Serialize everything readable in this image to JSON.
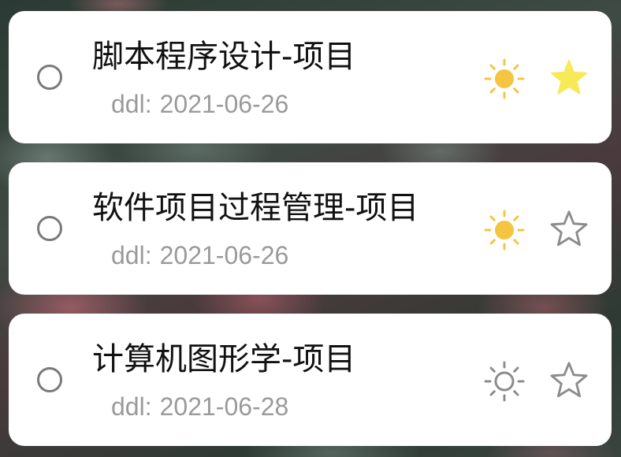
{
  "colors": {
    "card_background": "#ffffff",
    "title_text": "#111111",
    "ddl_text": "#9a9a9a",
    "radio_border": "#7a7a7a",
    "sun_active": "#f5c542",
    "sun_inactive": "#8c8c8c",
    "star_active": "#f7e957",
    "star_inactive": "#8c8c8c"
  },
  "tasks": [
    {
      "title": "脚本程序设计-项目",
      "ddl_prefix": "ddl:",
      "ddl_date": "2021-06-26",
      "my_day": true,
      "important": true,
      "sun_icon": "sun-icon",
      "star_icon": "star-filled-icon"
    },
    {
      "title": "软件项目过程管理-项目",
      "ddl_prefix": "ddl:",
      "ddl_date": "2021-06-26",
      "my_day": true,
      "important": false,
      "sun_icon": "sun-icon",
      "star_icon": "star-outline-icon"
    },
    {
      "title": "计算机图形学-项目",
      "ddl_prefix": "ddl:",
      "ddl_date": "2021-06-28",
      "my_day": false,
      "important": false,
      "sun_icon": "sun-outline-icon",
      "star_icon": "star-outline-icon"
    }
  ]
}
